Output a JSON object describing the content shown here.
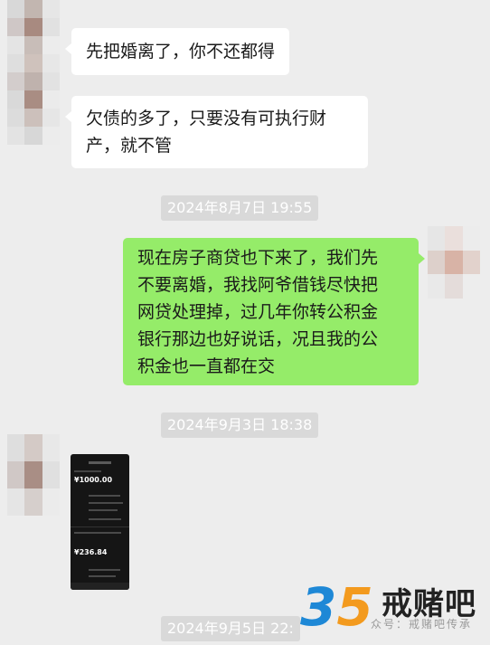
{
  "chat": {
    "messages": [
      {
        "text": "先把婚离了，你不还都得"
      },
      {
        "lines": [
          "欠债的多了，只要没有可执行财",
          "产，就不管"
        ]
      },
      {
        "lines": [
          "现在房子商贷也下来了，我们先",
          "不要离婚，我找阿爷借钱尽快把",
          "网贷处理掉，过几年你转公积金",
          "银行那边也好说话，况且我的公",
          "积金也一直都在交"
        ]
      }
    ],
    "timestamps": [
      "2024年8月7日 19:55",
      "2024年9月3日 18:38",
      "2024年9月5日 22:"
    ]
  },
  "screenshot_message": {
    "amount1": "¥1000.00",
    "amount2": "¥236.84"
  },
  "watermark": {
    "number": "35",
    "brand": "戒赌吧",
    "subtitle": "众号：戒赌吧传承",
    "colors": {
      "three": "#1e88d6",
      "five": "#f39a1e"
    }
  },
  "colors": {
    "background": "#ededed",
    "incoming_bubble": "#ffffff",
    "outgoing_bubble": "#95ec69",
    "timestamp_bg": "#d9d9d9"
  }
}
